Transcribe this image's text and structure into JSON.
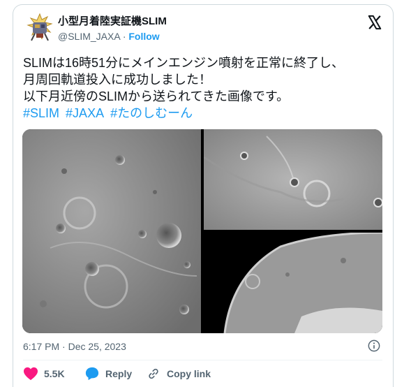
{
  "account": {
    "name": "小型月着陸実証機SLIM",
    "handle": "@SLIM_JAXA",
    "separator": "·",
    "follow_label": "Follow"
  },
  "tweet": {
    "lines": [
      "SLIMは16時51分にメインエンジン噴射を正常に終了し、",
      "月周回軌道投入に成功しました！",
      "以下月近傍のSLIMから送られてきた画像です。"
    ],
    "hashtags": [
      "#SLIM",
      "#JAXA",
      "#たのしむーん"
    ]
  },
  "meta": {
    "time": "6:17 PM",
    "separator": "·",
    "date": "Dec 25, 2023"
  },
  "actions": {
    "like_count": "5.5K",
    "reply_label": "Reply",
    "copy_link_label": "Copy link"
  },
  "colors": {
    "accent": "#1d9bf0",
    "like": "#f91880",
    "text": "#0f1419",
    "secondary": "#536471"
  },
  "icons": [
    "x-logo-icon",
    "info-icon",
    "heart-icon",
    "reply-bubble-icon",
    "link-icon"
  ]
}
